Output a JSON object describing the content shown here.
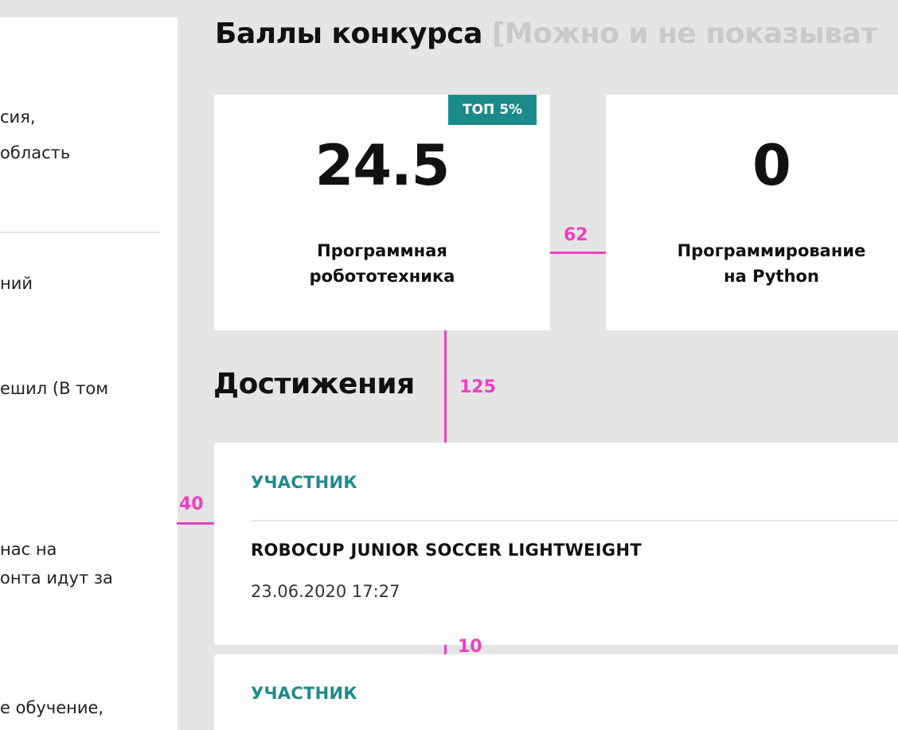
{
  "sidebar": {
    "lines": [
      "сия,",
      "область",
      "ний",
      "ешил (В том",
      "нас на",
      "онта идут за",
      "е обучение,"
    ]
  },
  "scores": {
    "title": "Баллы конкурса",
    "title_note": "[Можно и не показыват",
    "cards": [
      {
        "value": "24.5",
        "label_line1": "Программная",
        "label_line2": "робототехника",
        "badge": "ТОП 5%"
      },
      {
        "value": "0",
        "label_line1": "Программирование",
        "label_line2": "на Python"
      }
    ]
  },
  "achievements": {
    "title": "Достижения",
    "items": [
      {
        "status": "УЧАСТНИК",
        "name": "ROBOCUP JUNIOR SOCCER LIGHTWEIGHT",
        "date": "23.06.2020 17:27"
      },
      {
        "status": "УЧАСТНИК"
      }
    ]
  },
  "spacing_annotations": {
    "card_gap": "62",
    "section_gap": "125",
    "left_gap": "40",
    "item_gap": "10",
    "color": "#ee3fbf"
  },
  "colors": {
    "accent": "#1a8a8a",
    "background": "#e5e5e5",
    "card": "#ffffff"
  }
}
